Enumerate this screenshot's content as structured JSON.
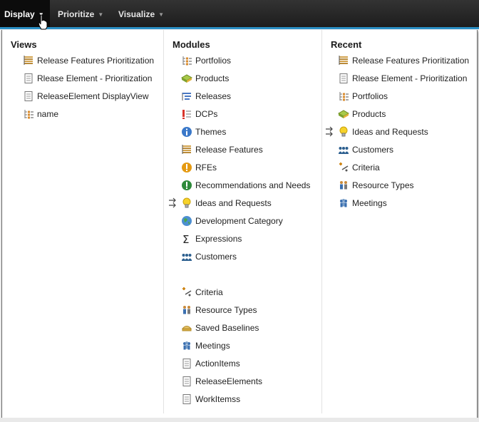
{
  "menubar": {
    "items": [
      {
        "label": "Display"
      },
      {
        "label": "Prioritize"
      },
      {
        "label": "Visualize"
      }
    ]
  },
  "views": {
    "title": "Views",
    "items": [
      {
        "label": "Release Features Prioritization",
        "icon": "release-features-icon"
      },
      {
        "label": "Rlease Element - Prioritization",
        "icon": "document-icon"
      },
      {
        "label": "ReleaseElement DisplayView",
        "icon": "document-icon"
      },
      {
        "label": "name",
        "icon": "portfolio-tree-icon"
      }
    ]
  },
  "modules": {
    "title": "Modules",
    "items": [
      {
        "label": "Portfolios",
        "icon": "portfolio-tree-icon"
      },
      {
        "label": "Products",
        "icon": "products-icon"
      },
      {
        "label": "Releases",
        "icon": "releases-icon"
      },
      {
        "label": "DCPs",
        "icon": "dcp-icon"
      },
      {
        "label": "Themes",
        "icon": "info-icon"
      },
      {
        "label": "Release Features",
        "icon": "release-features-icon"
      },
      {
        "label": "RFEs",
        "icon": "warning-icon"
      },
      {
        "label": "Recommendations and Needs",
        "icon": "recommendation-icon"
      },
      {
        "label": "Ideas and Requests",
        "icon": "lightbulb-icon"
      },
      {
        "label": "Development Category",
        "icon": "globe-icon"
      },
      {
        "label": "Expressions",
        "icon": "sigma-icon"
      },
      {
        "label": "Customers",
        "icon": "customers-icon"
      },
      {
        "label": "Criteria",
        "icon": "criteria-icon"
      },
      {
        "label": "Resource Types",
        "icon": "resource-types-icon"
      },
      {
        "label": "Saved Baselines",
        "icon": "baseline-icon"
      },
      {
        "label": "Meetings",
        "icon": "meetings-icon"
      },
      {
        "label": "ActionItems",
        "icon": "document-icon"
      },
      {
        "label": "ReleaseElements",
        "icon": "document-icon"
      },
      {
        "label": "WorkItemss",
        "icon": "document-icon"
      }
    ]
  },
  "recent": {
    "title": "Recent",
    "items": [
      {
        "label": "Release Features Prioritization",
        "icon": "release-features-icon"
      },
      {
        "label": "Rlease Element - Prioritization",
        "icon": "document-icon"
      },
      {
        "label": "Portfolios",
        "icon": "portfolio-tree-icon"
      },
      {
        "label": "Products",
        "icon": "products-icon"
      },
      {
        "label": "Ideas and Requests",
        "icon": "lightbulb-icon"
      },
      {
        "label": "Customers",
        "icon": "customers-icon"
      },
      {
        "label": "Criteria",
        "icon": "criteria-icon"
      },
      {
        "label": "Resource Types",
        "icon": "resource-types-icon"
      },
      {
        "label": "Meetings",
        "icon": "meetings-icon"
      }
    ]
  },
  "colors": {
    "menubar_bg": "#1c1c1c",
    "accent": "#2a8fc4",
    "menu_text": "#e6e6e6"
  }
}
